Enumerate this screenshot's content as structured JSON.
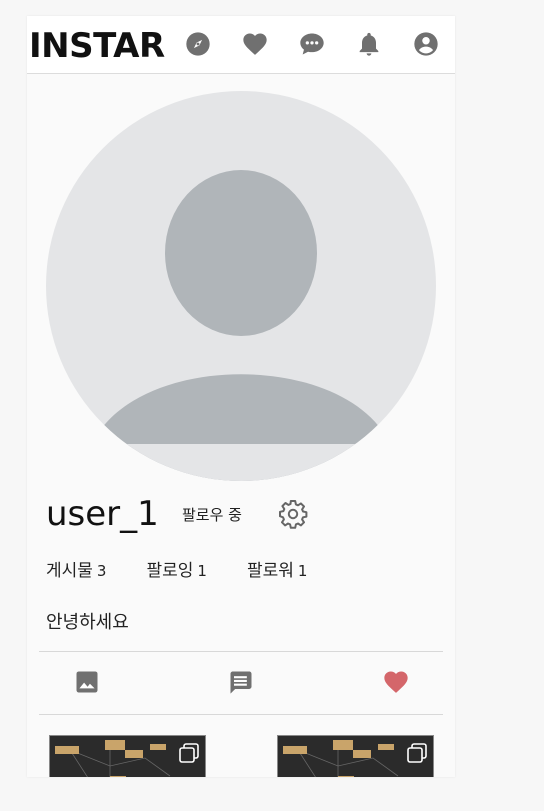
{
  "app": {
    "brand": "INSTAR"
  },
  "nav": {
    "icons": [
      "compass-icon",
      "heart-icon",
      "chat-icon",
      "bell-icon",
      "account-icon"
    ]
  },
  "profile": {
    "username": "user_1",
    "follow_state": "팔로우 중",
    "stats": [
      {
        "label": "게시물",
        "value": "3"
      },
      {
        "label": "팔로잉",
        "value": "1"
      },
      {
        "label": "팔로워",
        "value": "1"
      }
    ],
    "bio": "안녕하세요"
  },
  "tabs": [
    {
      "icon": "image-icon",
      "active": false
    },
    {
      "icon": "comment-icon",
      "active": false
    },
    {
      "icon": "heart-icon",
      "active": true
    }
  ],
  "colors": {
    "icon": "#707070",
    "active_heart": "#d4666a",
    "avatar_bg": "#e4e5e7",
    "avatar_figure": "#b0b5b9"
  }
}
